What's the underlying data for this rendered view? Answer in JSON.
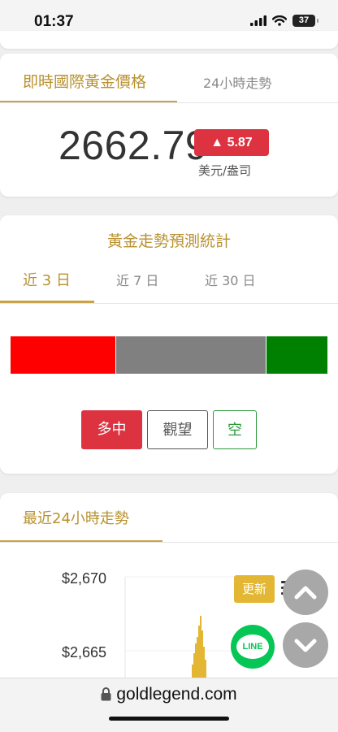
{
  "status_bar": {
    "time": "01:37",
    "battery": "37"
  },
  "price_card": {
    "tabs": [
      "即時國際黃金價格",
      "24小時走勢"
    ],
    "price": "2662.79",
    "change": "▲ 5.87",
    "unit": "美元/盎司"
  },
  "prediction": {
    "title": "黃金走勢預測統計",
    "tabs": [
      "近 3 日",
      "近 7 日",
      "近 30 日"
    ],
    "buttons": [
      "多中",
      "觀望",
      "空"
    ],
    "colors": {
      "bull": "#ff0000",
      "neutral": "#808080",
      "bear": "#008000"
    }
  },
  "chart_data": {
    "type": "bar",
    "title": "最近24小時走勢",
    "y_ticks": [
      "$2,670",
      "$2,665"
    ]
  },
  "floating": {
    "refresh_label": "更新",
    "line_label": "LINE"
  },
  "browser": {
    "url": "goldlegend.com"
  }
}
